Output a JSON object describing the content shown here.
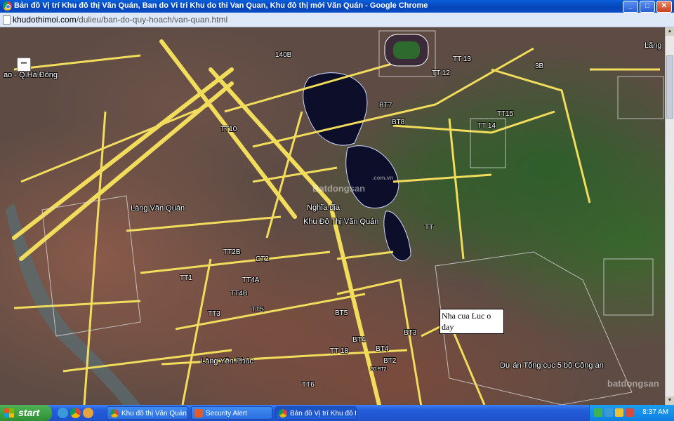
{
  "window": {
    "title": "Bản đồ Vị trí Khu đô thị Văn Quán, Ban do Vi tri Khu do thi Van Quan, Khu đô thị mới Văn Quán - Google Chrome",
    "controls": {
      "minimize": "_",
      "maximize": "□",
      "close": "✕"
    }
  },
  "addressbar": {
    "domain": "khudothimoi.com",
    "path": "/dulieu/ban-do-quy-hoach/van-quan.html"
  },
  "map": {
    "zoom_out_label": "−",
    "labels": {
      "lang": "Lăng",
      "ha_dong": "ao - Q.Hà Đông",
      "tt13": "TT 13",
      "tt12": "TT 12",
      "bt7": "BT7",
      "bt8": "BT8",
      "tt15": "TT15",
      "tt14": "TT 14",
      "tt10": "TT10",
      "lang_van_quan": "Làng Văn Quán",
      "nghia_dia": "Nghĩa địa",
      "khu_do_thi": "Khu Đô Thị Văn Quán",
      "tt": "TT",
      "tt2b": "TT2B",
      "ct2": "CT2",
      "tt1": "TT1",
      "tt4a": "TT4A",
      "tt4b": "TT4B",
      "tt5": "TT5",
      "tt3": "TT3",
      "bt5": "BT5",
      "bt3": "BT3",
      "bt4": "BT4",
      "tt18": "TT 18",
      "bt4b": "BT4",
      "bt2": "BT2",
      "tt6": "TT6",
      "lang_yen_phuc": "Làng Yên Phúc",
      "du_an": "Dự án Tổng cục 5 bộ Công an",
      "bt_small": "50 BT2",
      "n140b": "140B",
      "n3b": "3B"
    },
    "watermarks": [
      "Batdongsan",
      "batdongsan",
      ".com.vn"
    ],
    "annotation": "Nha cua Luc o day"
  },
  "taskbar": {
    "start_label": "start",
    "tasks": [
      {
        "label": "Khu đô thị Văn Quán,..."
      },
      {
        "label": "Security Alert"
      },
      {
        "label": "Bản đồ Vị trí Khu đô t..."
      }
    ],
    "clock": "8:37 AM"
  }
}
